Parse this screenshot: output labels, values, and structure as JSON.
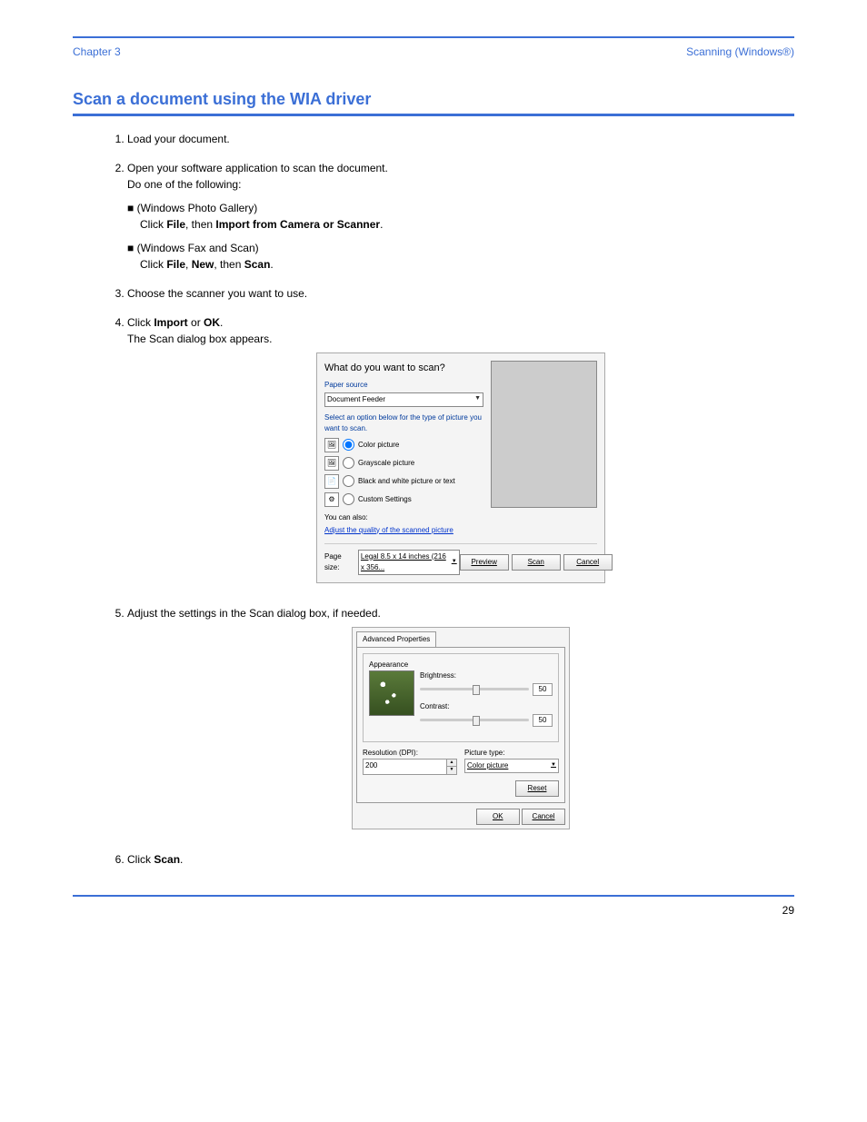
{
  "header": {
    "left": "Chapter 3",
    "right": "Scanning (Windows®)"
  },
  "section_title": "Scan a document using the WIA driver",
  "steps": {
    "s1": "Load your document.",
    "s2_a": "Open your software application to scan the document.",
    "s2_b": "Do one of the following:",
    "s2_b1": "(Windows Photo Gallery)",
    "s2_b1b_pre": "Click ",
    "s2_b1b_bold1": "File",
    "s2_b1b_mid": ", then ",
    "s2_b1b_bold2": "Import from Camera or Scanner",
    "s2_b1b_end": ".",
    "s2_b2": "(Windows Fax and Scan)",
    "s2_b2b_pre": "Click ",
    "s2_b2b_bold1": "File",
    "s2_b2b_mid1": ", ",
    "s2_b2b_bold2": "New",
    "s2_b2b_mid2": ", then ",
    "s2_b2b_bold3": "Scan",
    "s2_b2b_end": ".",
    "s3": "Choose the scanner you want to use.",
    "s4_pre": "Click ",
    "s4_bold": "Import",
    "s4_mid": " or ",
    "s4_bold2": "OK",
    "s4_end": ".",
    "s4_sub": "The Scan dialog box appears.",
    "s5": "Adjust the settings in the Scan dialog box, if needed.",
    "s6_pre": "Click ",
    "s6_bold": "Scan",
    "s6_end": "."
  },
  "dialog1": {
    "title": "What do you want to scan?",
    "paper_source_lbl": "Paper source",
    "paper_source_val": "Document Feeder",
    "select_desc": "Select an option below for the type of picture you want to scan.",
    "opt_color": "Color picture",
    "opt_gray": "Grayscale picture",
    "opt_bw": "Black and white picture or text",
    "opt_custom": "Custom Settings",
    "also_label": "You can also:",
    "adjust_link": "Adjust the quality of the scanned picture",
    "page_size_lbl": "Page size:",
    "page_size_val": "Legal 8.5 x 14 inches (216 x 356...",
    "btn_preview": "Preview",
    "btn_scan": "Scan",
    "btn_cancel": "Cancel"
  },
  "dialog2": {
    "tab": "Advanced Properties",
    "appearance": "Appearance",
    "brightness": "Brightness:",
    "brightness_val": "50",
    "contrast": "Contrast:",
    "contrast_val": "50",
    "resolution_lbl": "Resolution (DPI):",
    "resolution_val": "200",
    "picture_type_lbl": "Picture type:",
    "picture_type_val": "Color picture",
    "btn_reset": "Reset",
    "btn_ok": "OK",
    "btn_cancel": "Cancel"
  },
  "footer": {
    "left": "",
    "right": "29"
  }
}
